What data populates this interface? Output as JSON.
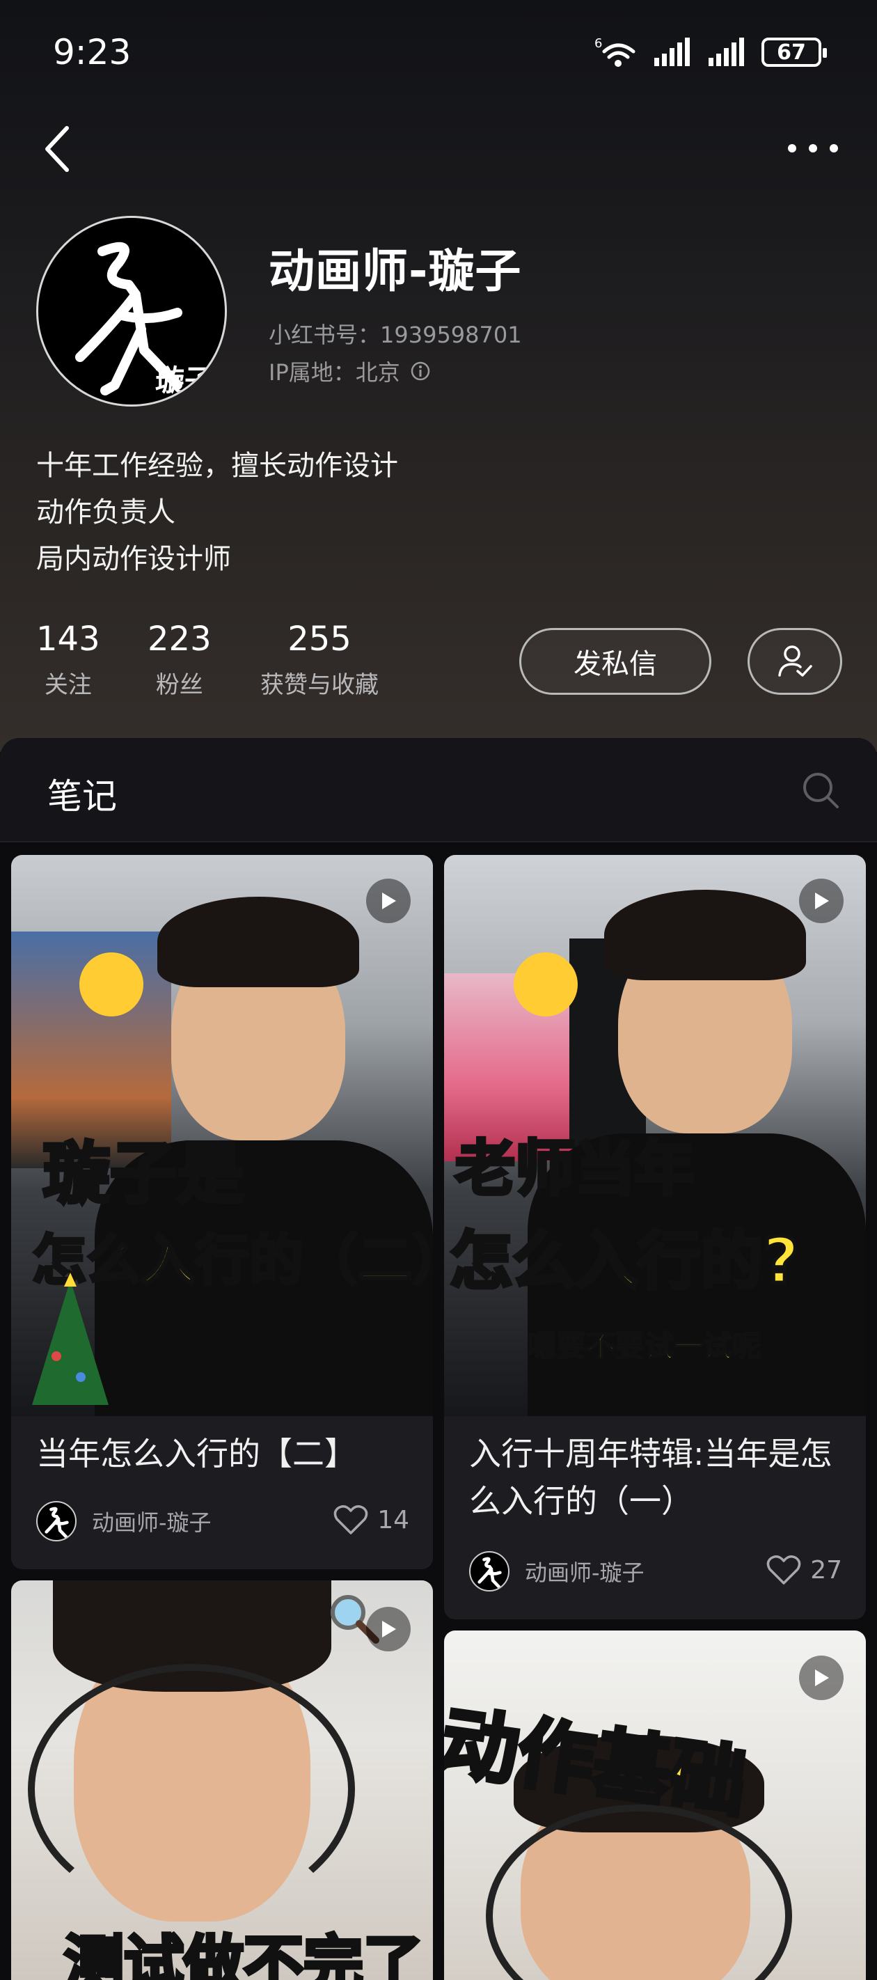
{
  "status_bar": {
    "time": "9:23",
    "network": "6",
    "battery": "67"
  },
  "profile": {
    "name": "动画师-璇子",
    "red_id": "小红书号：1939598701",
    "ip": "IP属地：北京",
    "avatar_text": "璇子",
    "bio": [
      "十年工作经验，擅长动作设计",
      "动作负责人",
      "局内动作设计师"
    ]
  },
  "stats": [
    {
      "value": "143",
      "label": "关注"
    },
    {
      "value": "223",
      "label": "粉丝"
    },
    {
      "value": "255",
      "label": "获赞与收藏"
    }
  ],
  "actions": {
    "message_label": "发私信"
  },
  "tabs": {
    "notes_label": "笔记"
  },
  "notes": [
    {
      "title": "当年怎么入行的【二】",
      "author": "动画师-璇子",
      "likes": "14",
      "overlay_line1": "璇子是",
      "overlay_line2": "怎么入行的（二）"
    },
    {
      "title": "入行十周年特辑:当年是怎么入行的（一）",
      "author": "动画师-璇子",
      "likes": "27",
      "overlay_line1": "老师当年",
      "overlay_line2": "怎么入行的?",
      "overlay_line3": "嗯要不要试一试呢"
    },
    {
      "overlay_line1": "测试做不完了"
    },
    {
      "overlay_line1": "动作基础"
    }
  ],
  "colors": {
    "background": "#0e0e12",
    "card": "#1c1c21",
    "overlay_cyan": "#3ad0e6",
    "overlay_yellow": "#ffe53a"
  }
}
